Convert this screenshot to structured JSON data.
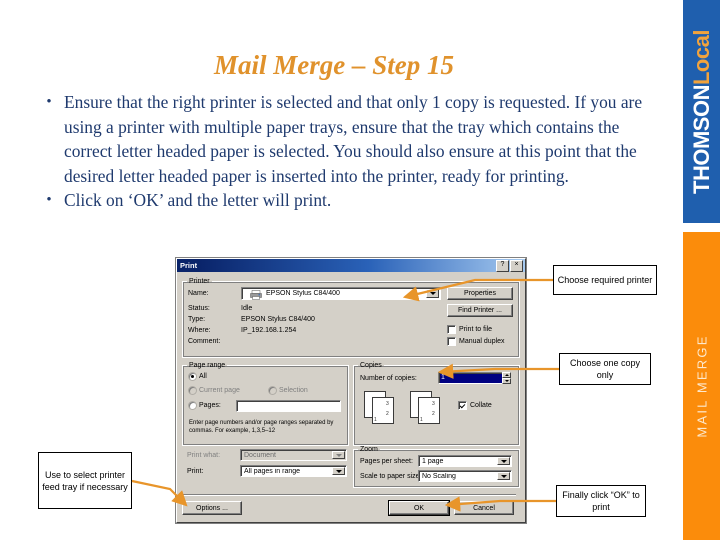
{
  "slide": {
    "title": "Mail Merge – Step 15",
    "title_color": "#e0922c",
    "body_color": "#1f3a6e",
    "bullets": [
      "Ensure that the right printer is selected and that only 1 copy is requested.  If you are using a printer with multiple paper trays, ensure that the tray which contains the correct letter headed paper is selected.  You should also ensure at this point that the desired letter headed paper is inserted into the printer, ready for printing.",
      "Click on ‘OK’ and the letter will print."
    ],
    "bullet_marker": "•"
  },
  "brand": {
    "blue_color": "#1f5fae",
    "orange_color": "#fb8c0b",
    "thomson": "THOMSON",
    "local": "Local",
    "section_label": "MAIL MERGE"
  },
  "print_dialog": {
    "title": "Print",
    "help_button": "?",
    "close_button": "×",
    "printer_group": {
      "legend": "Printer",
      "name_label": "Name:",
      "name_value": "EPSON Stylus C84/400",
      "status_label": "Status:",
      "status_value": "Idle",
      "type_label": "Type:",
      "type_value": "EPSON Stylus C84/400",
      "where_label": "Where:",
      "where_value": "IP_192.168.1.254",
      "comment_label": "Comment:",
      "comment_value": "",
      "properties_button": "Properties",
      "find_printer_button": "Find Printer ...",
      "print_to_file_checkbox": "Print to file",
      "manual_duplex_checkbox": "Manual duplex"
    },
    "page_range_group": {
      "legend": "Page range",
      "all_radio": "All",
      "current_page_radio": "Current page",
      "selection_radio": "Selection",
      "pages_radio": "Pages:",
      "pages_value": "",
      "hint": "Enter page numbers and/or page ranges separated by commas. For example, 1,3,5–12"
    },
    "copies_group": {
      "legend": "Copies",
      "number_label": "Number of copies:",
      "number_value": "1",
      "collate_checkbox": "Collate"
    },
    "print_what_label": "Print what:",
    "print_what_value": "Document",
    "print_label": "Print:",
    "print_value": "All pages in range",
    "zoom_group": {
      "legend": "Zoom",
      "pages_per_sheet_label": "Pages per sheet:",
      "pages_per_sheet_value": "1 page",
      "scale_label": "Scale to paper size:",
      "scale_value": "No Scaling"
    },
    "options_button": "Options ...",
    "ok_button": "OK",
    "cancel_button": "Cancel"
  },
  "callouts": {
    "printer": "Choose required printer",
    "copies": "Choose one copy only",
    "tray": "Use to select printer feed tray if necessary",
    "ok": "Finally click “OK” to print",
    "arrow_color": "#e8952a"
  }
}
